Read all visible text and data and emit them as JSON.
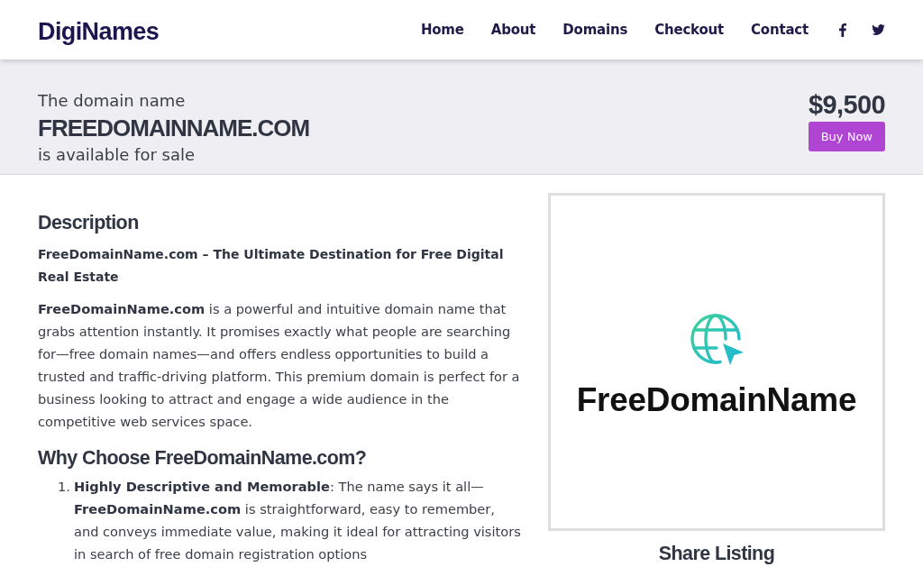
{
  "header": {
    "logo": "DigiNames",
    "nav": [
      {
        "label": "Home"
      },
      {
        "label": "About"
      },
      {
        "label": "Domains"
      },
      {
        "label": "Checkout"
      },
      {
        "label": "Contact"
      }
    ],
    "social": [
      {
        "kind": "facebook"
      },
      {
        "kind": "twitter"
      }
    ]
  },
  "banner": {
    "intro": "The domain name",
    "domain": "FREEDOMAINNAME.COM",
    "status": "is available for sale",
    "price": "$9,500",
    "buy_button": "Buy Now"
  },
  "description": {
    "heading": "Description",
    "subtitle": "FreeDomainName.com – The Ultimate Destination for Free Digital Real Estate",
    "paragraph": "**FreeDomainName.com** is a powerful and intuitive domain name that grabs attention instantly. It promises exactly what people are searching for—free domain names—and offers endless opportunities to build a trusted and traffic-driving platform. This premium domain is perfect for a business looking to attract and engage a wide audience in the competitive web services space."
  },
  "why_choose": {
    "heading": "Why Choose FreeDomainName.com?",
    "items": [
      {
        "number": "1.",
        "text": "**Highly Descriptive and Memorable**: The name says it all—**FreeDomainName.com** is straightforward, easy to remember, and conveys immediate value, making it ideal for attracting visitors in search of free domain registration options"
      }
    ]
  },
  "logo_card": {
    "text": "FreeDomainName"
  },
  "share": {
    "heading": "Share Listing"
  }
}
